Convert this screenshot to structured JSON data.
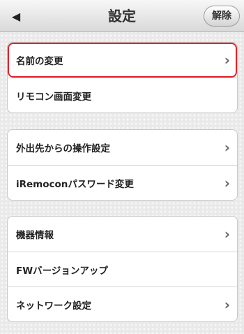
{
  "header": {
    "title": "設定",
    "back_icon": "◀",
    "unlock_label": "解除"
  },
  "groups": [
    {
      "items": [
        {
          "label": "名前の変更",
          "chevron": "›",
          "selected": true
        },
        {
          "label": "リモコン画面変更",
          "chevron": ""
        }
      ]
    },
    {
      "items": [
        {
          "label": "外出先からの操作設定",
          "chevron": "›"
        },
        {
          "label": "iRemoconパスワード変更",
          "chevron": "›"
        }
      ]
    },
    {
      "items": [
        {
          "label": "機器情報",
          "chevron": "›"
        },
        {
          "label": "FWバージョンアップ",
          "chevron": ""
        },
        {
          "label": "ネットワーク設定",
          "chevron": "›"
        }
      ]
    }
  ],
  "colors": {
    "highlight": "#e0232c"
  }
}
